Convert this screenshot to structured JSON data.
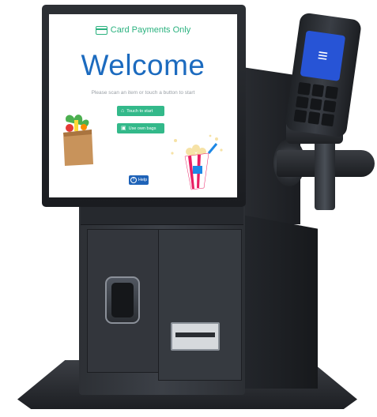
{
  "screen": {
    "header": {
      "label": "Card Payments Only",
      "icon": "credit-card-icon"
    },
    "title": "Welcome",
    "subtitle": "Please scan an item or touch a button to start",
    "buttons": {
      "start_label": "Touch to start",
      "start_icon": "basket-icon",
      "bags_label": "Use own bags",
      "bags_icon": "bag-icon"
    },
    "help": {
      "label": "Help",
      "icon": "question-circle-icon"
    }
  },
  "terminal": {
    "screen_icon": "contactless-icon"
  },
  "colors": {
    "accent_green": "#33b98a",
    "title_blue": "#1c6bbf",
    "help_blue": "#1f63b8",
    "kiosk_body": "#2d3035"
  }
}
